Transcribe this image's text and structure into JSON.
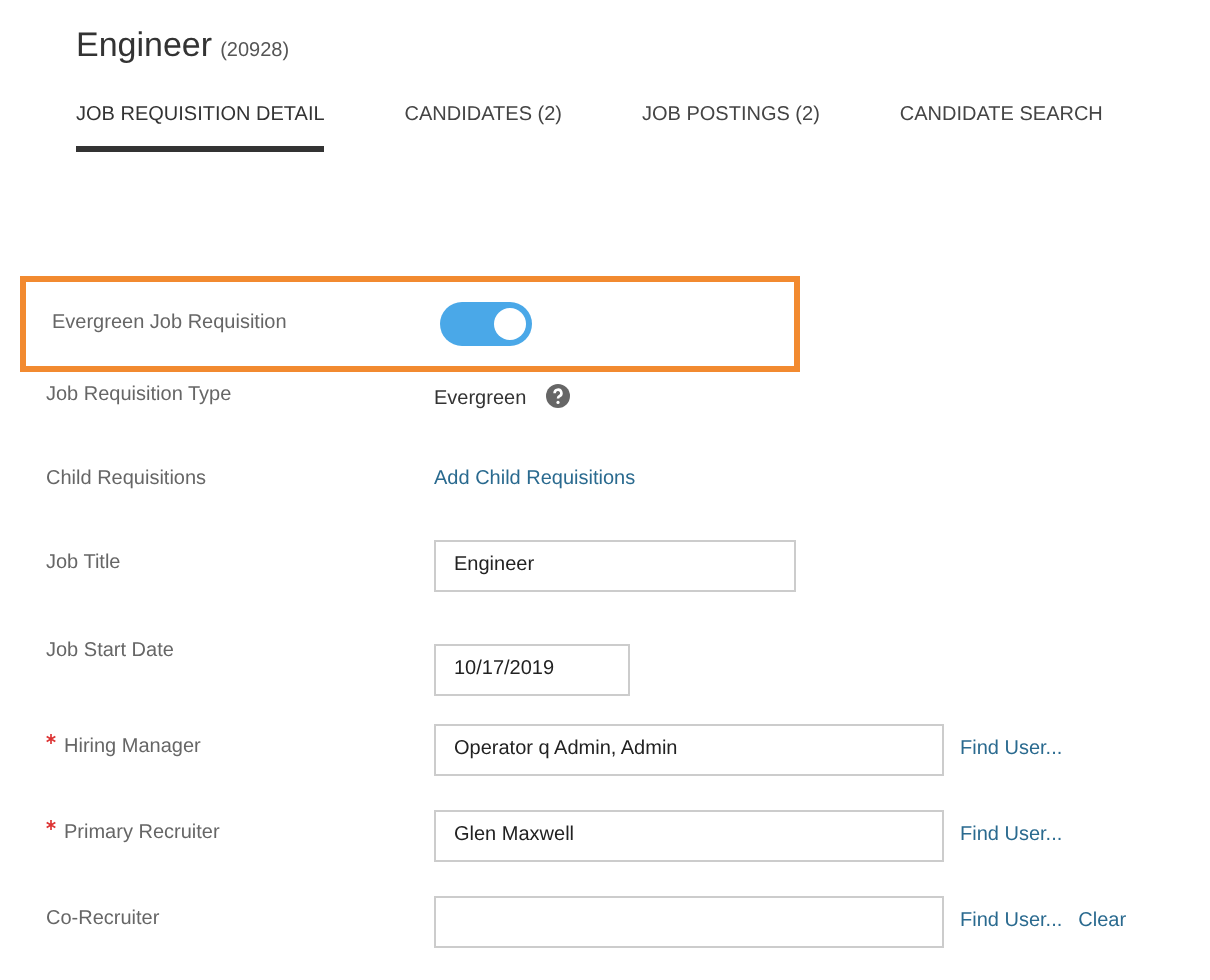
{
  "header": {
    "title": "Engineer",
    "id": "(20928)"
  },
  "tabs": [
    {
      "label": "JOB REQUISITION DETAIL",
      "selected": true
    },
    {
      "label": "CANDIDATES (2)",
      "selected": false
    },
    {
      "label": "JOB POSTINGS (2)",
      "selected": false
    },
    {
      "label": "CANDIDATE SEARCH",
      "selected": false
    }
  ],
  "fields": [
    {
      "kind": "toggle",
      "label": "Evergreen Job Requisition",
      "required": false,
      "highlighted": true,
      "on": true
    },
    {
      "kind": "static",
      "label": "Job Requisition Type",
      "required": false,
      "highlighted": false,
      "value": "Evergreen",
      "help": true
    },
    {
      "kind": "link",
      "label": "Child Requisitions",
      "required": false,
      "highlighted": false,
      "value": "Add Child Requisitions"
    },
    {
      "kind": "text_input",
      "label": "Job Title",
      "required": false,
      "highlighted": false,
      "value": "Engineer"
    },
    {
      "kind": "date_input",
      "label": "Job Start Date",
      "required": false,
      "highlighted": false,
      "value": "10/17/2019"
    },
    {
      "kind": "user_input",
      "label": "Hiring Manager",
      "required": true,
      "highlighted": false,
      "value": "Operator q Admin, Admin",
      "actions": [
        "Find User..."
      ]
    },
    {
      "kind": "user_input",
      "label": "Primary Recruiter",
      "required": true,
      "highlighted": false,
      "value": "Glen Maxwell",
      "actions": [
        "Find User..."
      ]
    },
    {
      "kind": "user_input",
      "label": "Co-Recruiter",
      "required": false,
      "highlighted": false,
      "actions": [
        "Find User...",
        "Clear"
      ]
    }
  ]
}
